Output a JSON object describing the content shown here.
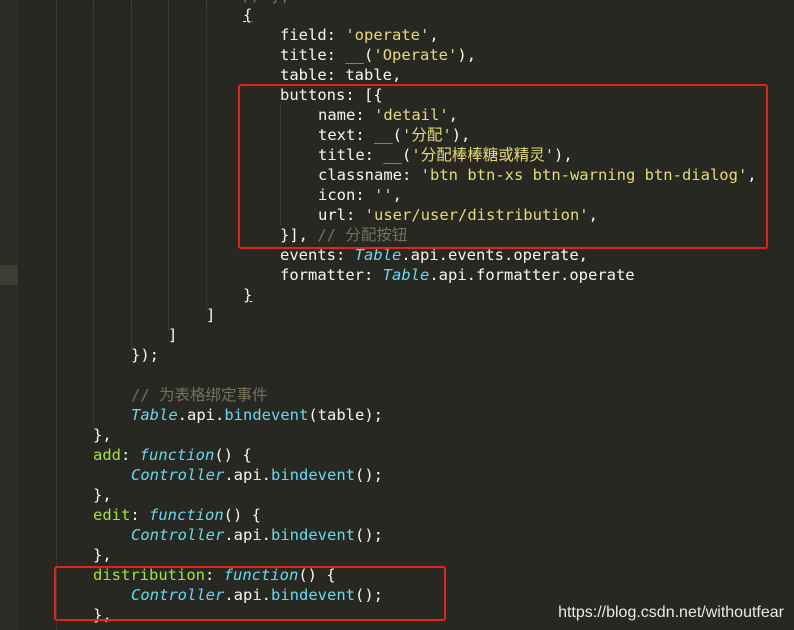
{
  "colors": {
    "background": "#272822",
    "text": "#f8f8f2",
    "string": "#e6db74",
    "comment": "#75715e",
    "function_keyword": "#66d9ef",
    "method": "#a6e22e",
    "highlight_box": "#e8201a"
  },
  "code": {
    "line_top": "// },",
    "open_brace": "{",
    "field_key": "field",
    "field_val": "'operate'",
    "title_key": "title",
    "title_fn": "__",
    "title_val": "'Operate'",
    "table_key": "table",
    "table_val": "table",
    "buttons_key": "buttons",
    "name_key": "name",
    "name_val": "'detail'",
    "text_key": "text",
    "text_fn": "__",
    "text_val": "'分配'",
    "btitle_key": "title",
    "btitle_fn": "__",
    "btitle_val": "'分配棒棒糖或精灵'",
    "classname_key": "classname",
    "classname_val": "'btn btn-xs btn-warning btn-dialog'",
    "icon_key": "icon",
    "icon_val": "''",
    "url_key": "url",
    "url_val": "'user/user/distribution'",
    "buttons_close": "}],",
    "buttons_comment": "// 分配按钮",
    "events_key": "events",
    "events_cls": "Table",
    "events_rest": ".api.events.operate,",
    "formatter_key": "formatter",
    "formatter_cls": "Table",
    "formatter_rest": ".api.formatter.operate",
    "close_brace": "}",
    "close_bracket1": "]",
    "close_bracket2": "]",
    "close_call": "});",
    "bind_comment": "// 为表格绑定事件",
    "bind_cls": "Table",
    "bind_api": ".api.",
    "bind_method": "bindevent",
    "bind_args": "(table);",
    "close_obj1": "},",
    "add_key": "add",
    "fn_keyword": "function",
    "fn_sig": "() {",
    "ctrl_cls": "Controller",
    "ctrl_api": ".api.",
    "ctrl_method": "bindevent",
    "ctrl_args": "();",
    "close_obj2": "},",
    "edit_key": "edit",
    "close_obj3": "},",
    "dist_key": "distribution",
    "close_obj4": "},"
  },
  "watermark": "https://blog.csdn.net/withoutfear"
}
